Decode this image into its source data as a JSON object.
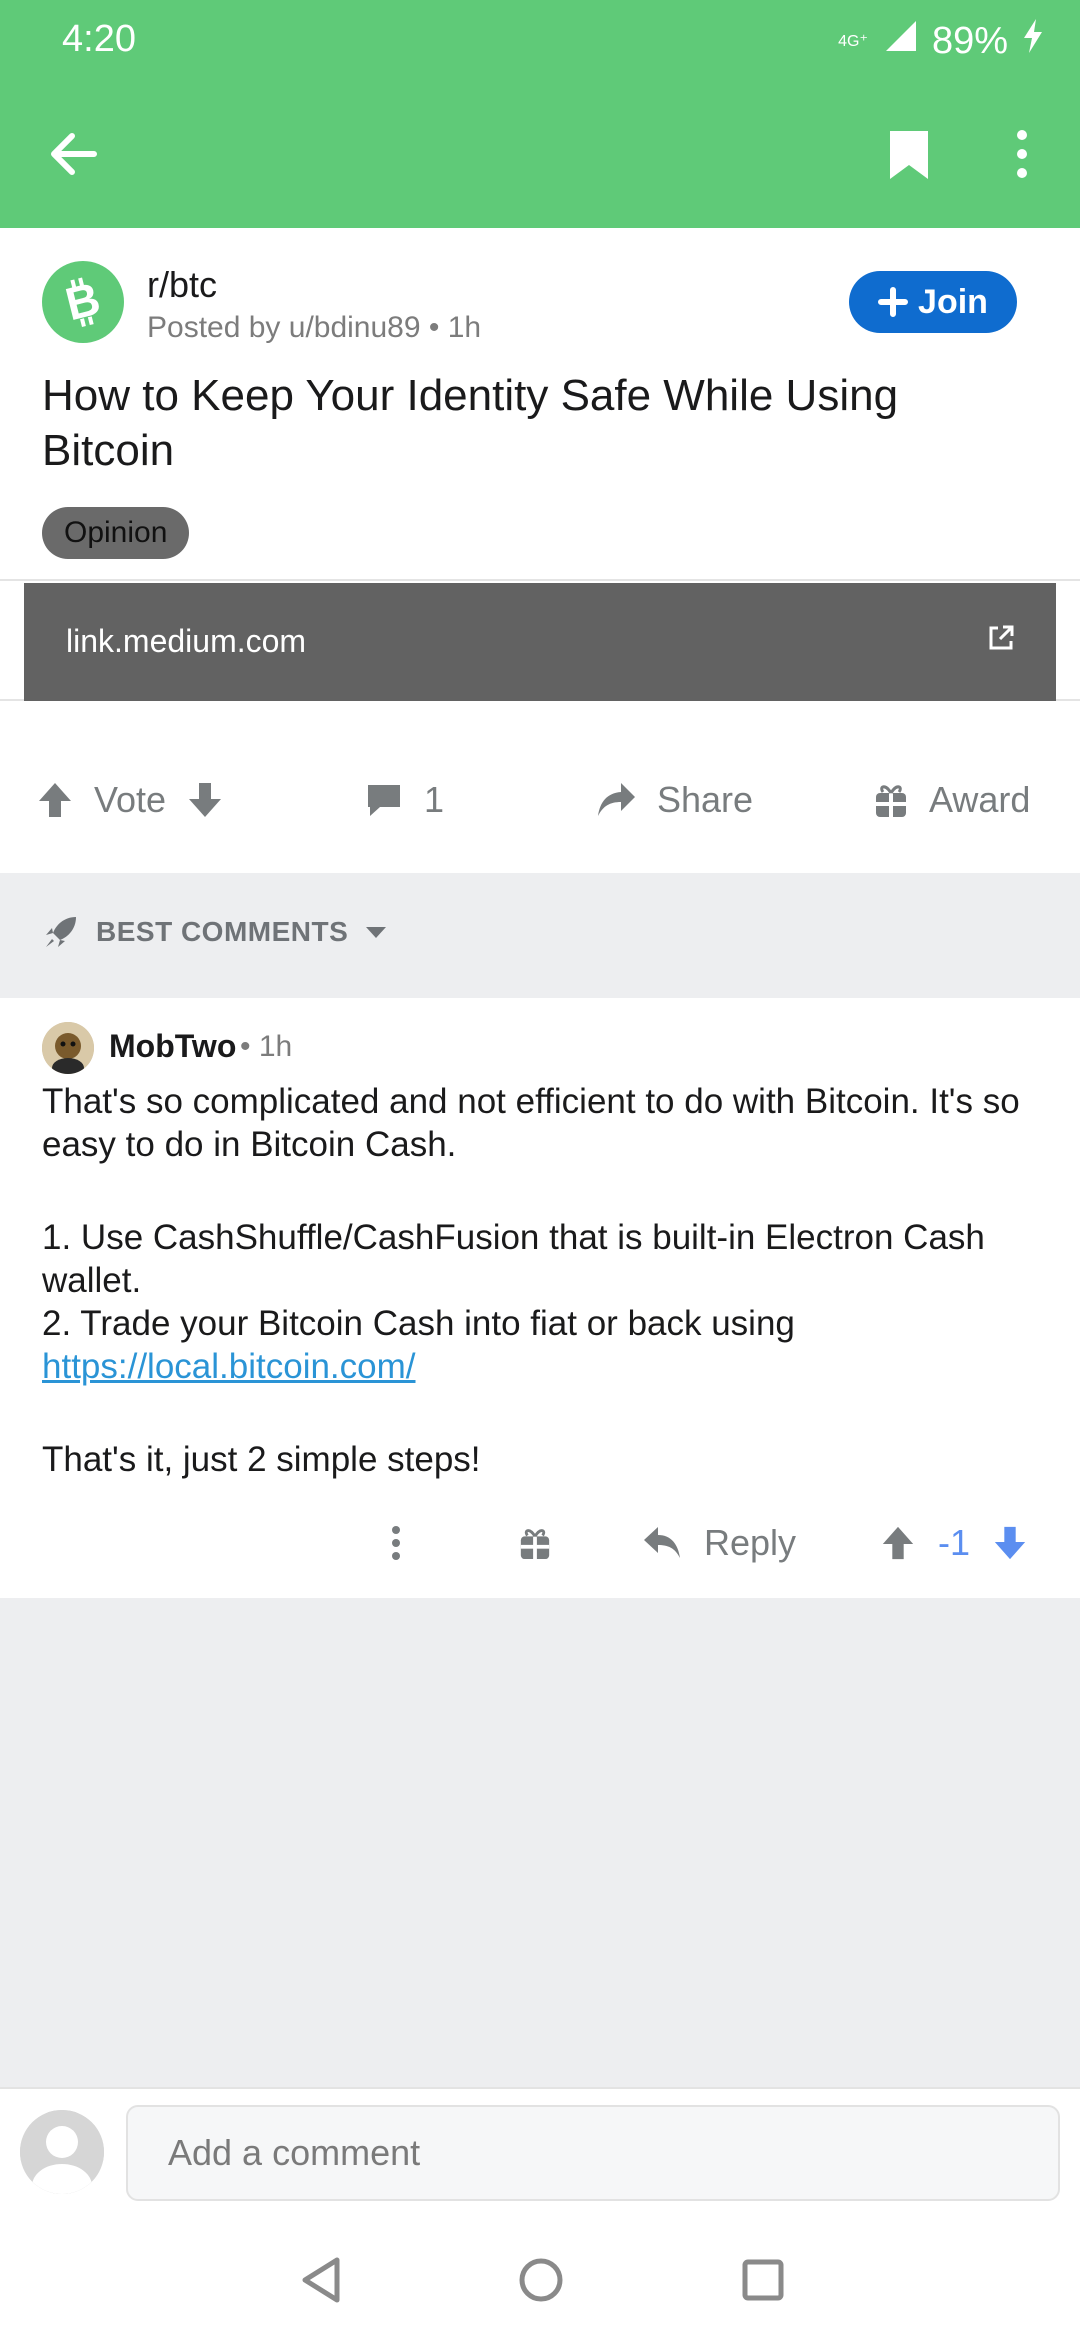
{
  "status_bar": {
    "time": "4:20",
    "network": "4G⁺",
    "battery": "89%"
  },
  "toolbar": {
    "back_icon": "arrow-left-icon",
    "bookmark_icon": "bookmark-icon",
    "more_icon": "more-vertical-icon"
  },
  "post": {
    "subreddit": "r/btc",
    "posted_by": "Posted by u/bdinu89 • 1h",
    "join_label": "Join",
    "title": "How to Keep Your Identity Safe While Using Bitcoin",
    "flair": "Opinion",
    "link_domain": "link.medium.com"
  },
  "actions": {
    "vote_label": "Vote",
    "comment_count": "1",
    "share_label": "Share",
    "award_label": "Award"
  },
  "sort": {
    "label": "BEST COMMENTS"
  },
  "comment": {
    "author": "MobTwo",
    "time": "• 1h",
    "body": {
      "p1": "That's so complicated and not efficient to do with Bitcoin. It's so easy to do in Bitcoin Cash.",
      "li1": "1. Use CashShuffle/CashFusion that is built-in Electron Cash wallet.",
      "li2": "2. Trade your Bitcoin Cash into fiat or back using",
      "link": "https://local.bitcoin.com/",
      "p3": "That's it, just 2 simple steps!"
    },
    "reply_label": "Reply",
    "score": "-1"
  },
  "composer": {
    "placeholder": "Add a comment"
  },
  "colors": {
    "app_bar": "#5fca78",
    "join_button": "#0f6ccf",
    "downvote_active": "#5b8ef0",
    "link": "#2a94d6"
  }
}
